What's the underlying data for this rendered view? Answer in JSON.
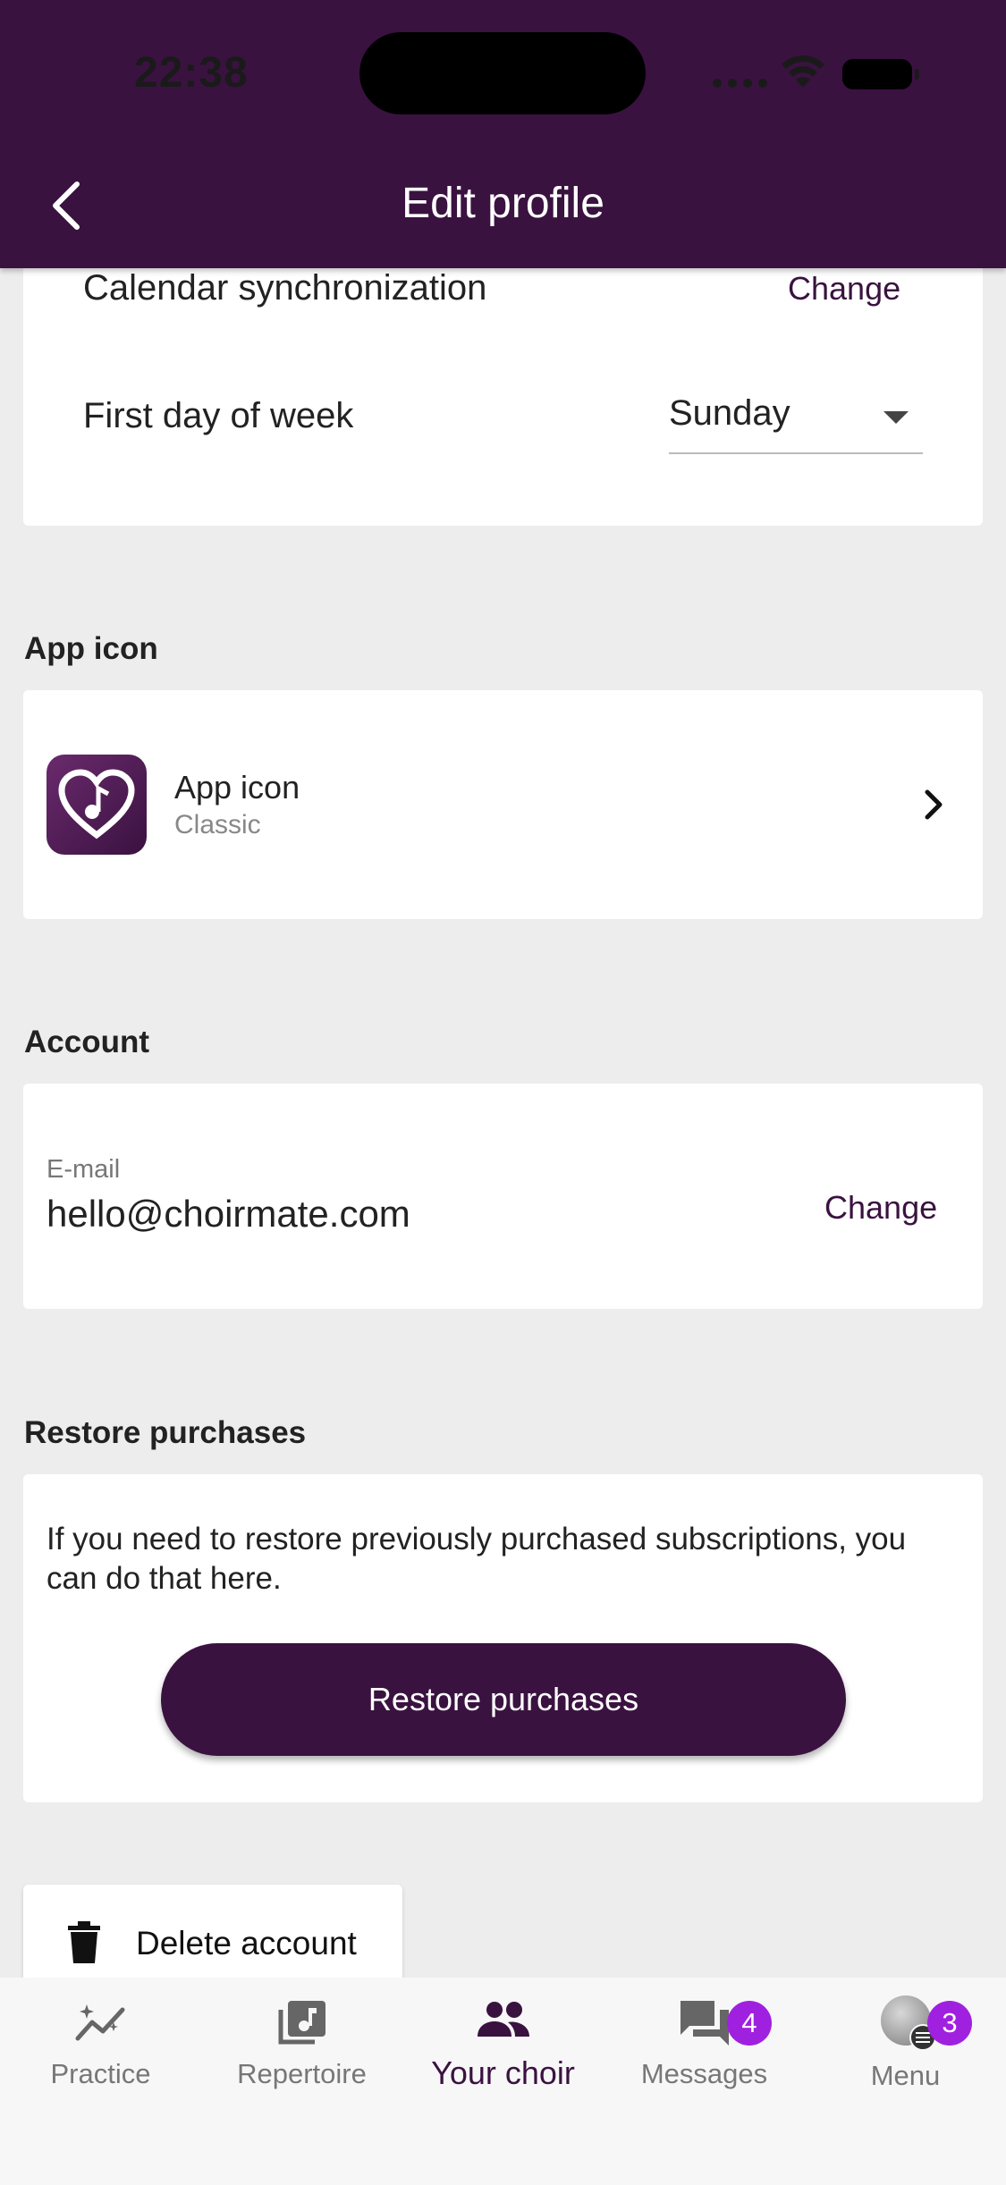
{
  "status_bar": {
    "time": "22:38"
  },
  "header": {
    "title": "Edit profile"
  },
  "calendar": {
    "label": "Calendar synchronization",
    "action": "Change"
  },
  "week": {
    "label": "First day of week",
    "value": "Sunday"
  },
  "app_icon_section": {
    "heading": "App icon",
    "item_title": "App icon",
    "item_subtitle": "Classic"
  },
  "account": {
    "heading": "Account",
    "email_label": "E-mail",
    "email_value": "hello@choirmate.com",
    "action": "Change"
  },
  "restore": {
    "heading": "Restore purchases",
    "description": "If you need to restore previously purchased subscriptions, you can do that here.",
    "button": "Restore purchases"
  },
  "delete": {
    "label": "Delete account"
  },
  "nav": {
    "items": [
      {
        "label": "Practice",
        "icon": "chart-sparkle-icon"
      },
      {
        "label": "Repertoire",
        "icon": "music-library-icon"
      },
      {
        "label": "Your choir",
        "icon": "group-icon"
      },
      {
        "label": "Messages",
        "icon": "chat-icon",
        "badge": "4"
      },
      {
        "label": "Menu",
        "icon": "avatar",
        "badge": "3"
      }
    ],
    "active": "Your choir"
  },
  "colors": {
    "brand": "#3a1240",
    "badge": "#a020e0",
    "background": "#eeedee"
  }
}
